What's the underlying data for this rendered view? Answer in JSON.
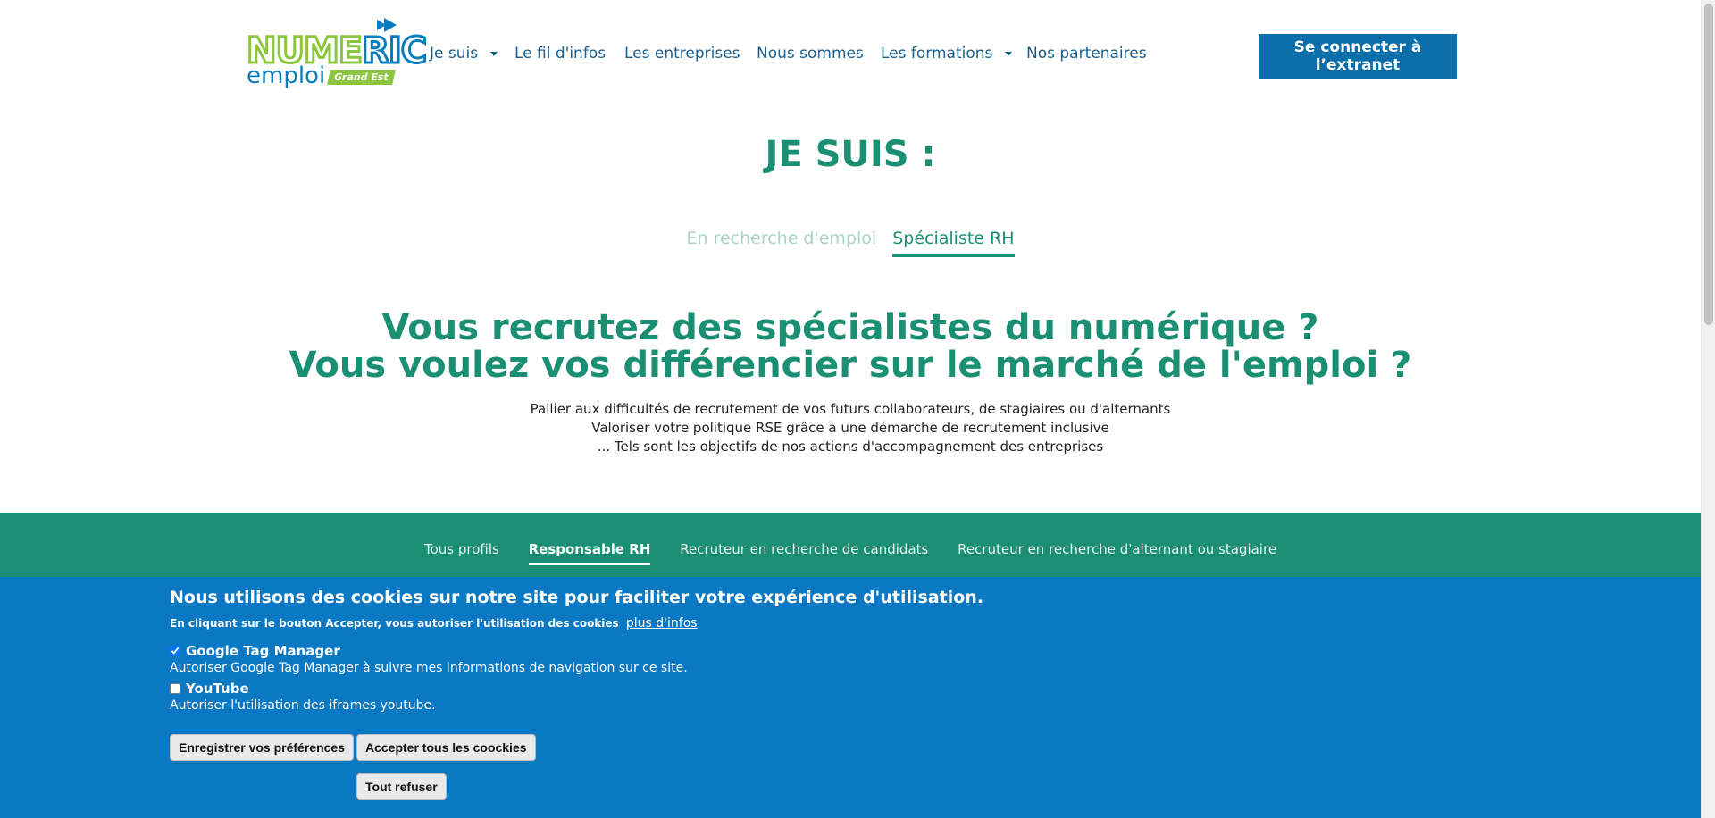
{
  "logo": {
    "text_numeric": "NUMERIC",
    "text_emploi": "emploi",
    "text_region": "Grand Est",
    "color_green": "#8cc63f",
    "color_blue": "#0a7dbf"
  },
  "nav": {
    "items": [
      {
        "label": "Je suis",
        "has_dropdown": true
      },
      {
        "label": "Le fil d'infos",
        "has_dropdown": false
      },
      {
        "label": "Les entreprises",
        "has_dropdown": false
      },
      {
        "label": "Nous sommes",
        "has_dropdown": false
      },
      {
        "label": "Les formations",
        "has_dropdown": true
      },
      {
        "label": "Nos partenaires",
        "has_dropdown": false
      }
    ],
    "extranet_button": "Se connecter à l’extranet"
  },
  "main": {
    "title": "JE SUIS :",
    "tabs": [
      {
        "label": "En recherche d'emploi",
        "active": false
      },
      {
        "label": "Spécialiste RH",
        "active": true
      }
    ],
    "headline_line1": "Vous recrutez des spécialistes du numérique ?",
    "headline_line2": "Vous voulez vos différencier sur le marché de l'emploi ?",
    "intro_lines": [
      "Pallier aux difficultés de recrutement de vos futurs collaborateurs, de stagiaires ou d'alternants",
      "Valoriser votre politique RSE grâce à une démarche de recrutement inclusive",
      "... Tels sont les objectifs de nos actions d'accompagnement des entreprises"
    ]
  },
  "profiles": {
    "tabs": [
      {
        "label": "Tous profils",
        "active": false
      },
      {
        "label": "Responsable RH",
        "active": true
      },
      {
        "label": "Recruteur en recherche de candidats",
        "active": false
      },
      {
        "label": "Recruteur en recherche d'alternant ou stagiaire",
        "active": false
      }
    ]
  },
  "cookie": {
    "title": "Nous utilisons des cookies sur notre site pour faciliter votre expérience d'utilisation.",
    "subtitle": "En cliquant sur le bouton Accepter, vous autoriser l'utilisation des cookies",
    "more_link": "plus d'infos",
    "options": [
      {
        "name": "Google Tag Manager",
        "checked": true,
        "description": "Autoriser Google Tag Manager à suivre mes informations de navigation sur ce site."
      },
      {
        "name": "YouTube",
        "checked": false,
        "description": "Autoriser l'utilisation des iframes youtube."
      }
    ],
    "buttons": {
      "save": "Enregistrer vos préférences",
      "accept_all": "Accepter tous les coockies",
      "refuse_all": "Tout refuser"
    }
  },
  "colors": {
    "brand_green": "#1a8f74",
    "nav_blue": "#1b5e8c",
    "button_blue": "#0b6ea8",
    "cookie_blue": "#0a78c2"
  }
}
